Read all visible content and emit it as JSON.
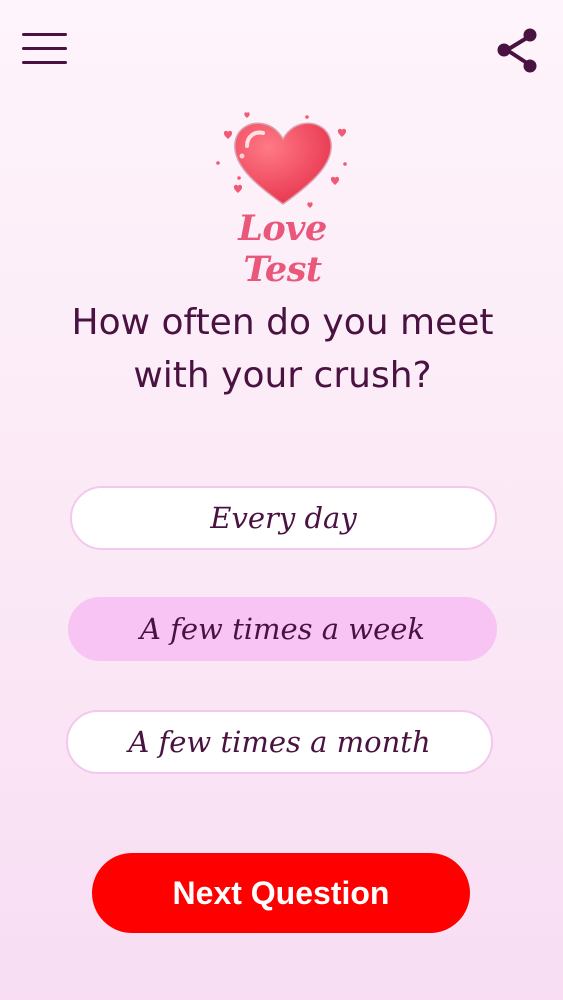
{
  "header": {
    "menu_icon": "hamburger-menu-icon",
    "share_icon": "share-icon"
  },
  "logo": {
    "text": "Love Test",
    "icon": "heart-icon"
  },
  "quiz": {
    "question": "How often do you meet with your crush?",
    "options": [
      {
        "label": "Every day",
        "selected": false
      },
      {
        "label": "A few times a week",
        "selected": true
      },
      {
        "label": "A few times a month",
        "selected": false
      }
    ],
    "next_label": "Next Question"
  },
  "colors": {
    "text": "#4a1240",
    "accent_red": "#ff0000",
    "logo_pink": "#e9577a",
    "selected_option": "#f7c4f3",
    "option_border": "#f3c8ec"
  }
}
